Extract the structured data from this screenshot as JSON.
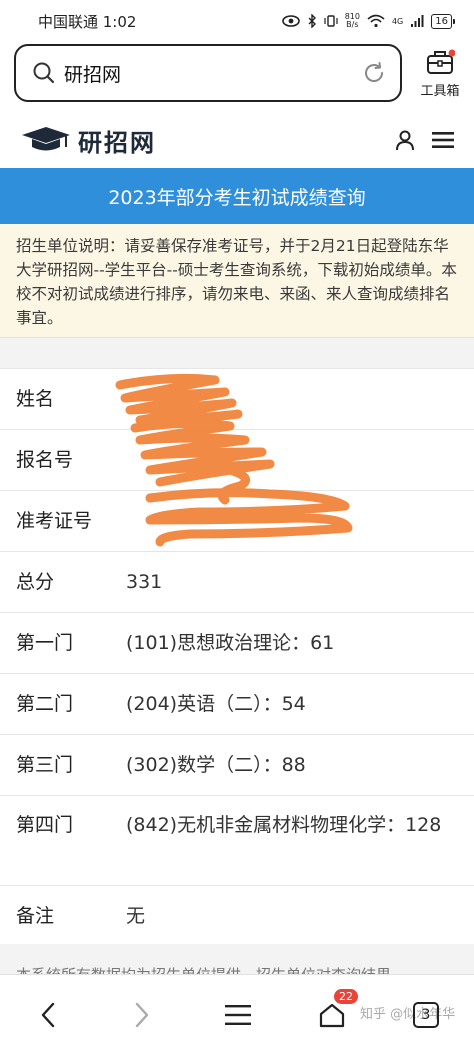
{
  "status_bar": {
    "carrier_time": "中国联通 1:02",
    "net_speed_value": "810",
    "net_speed_unit": "B/s",
    "signal": "4G",
    "battery": "16"
  },
  "browser": {
    "search_text": "研招网",
    "toolbox_label": "工具箱"
  },
  "site": {
    "logo_text": "研招网"
  },
  "page": {
    "banner_title": "2023年部分考生初试成绩查询",
    "notice": "招生单位说明：请妥善保存准考证号，并于2月21日起登陆东华大学研招网--学生平台--硕士考生查询系统，下载初始成绩单。本校不对初试成绩进行排序，请勿来电、来函、来人查询成绩排名事宜。",
    "rows": [
      {
        "label": "姓名",
        "value": ""
      },
      {
        "label": "报名号",
        "value": ""
      },
      {
        "label": "准考证号",
        "value": ""
      },
      {
        "label": "总分",
        "value": "331"
      },
      {
        "label": "第一门",
        "value": "(101)思想政治理论：61"
      },
      {
        "label": "第二门",
        "value": "(204)英语（二）：54"
      },
      {
        "label": "第三门",
        "value": "(302)数学（二）：88"
      },
      {
        "label": "第四门",
        "value": "(842)无机非金属材料物理化学：128"
      },
      {
        "label": "备注",
        "value": "无"
      }
    ],
    "footer_text": "本系统所有数据均为招生单位提供，招生单位对查询结果"
  },
  "bottom_nav": {
    "notification_count": "22",
    "tab_count": "3",
    "watermark": "知乎 @似水年华"
  },
  "colors": {
    "banner": "#2f8fdb",
    "notice_bg": "#fcf6e4",
    "redaction": "#f0843a",
    "badge": "#e8443a"
  }
}
